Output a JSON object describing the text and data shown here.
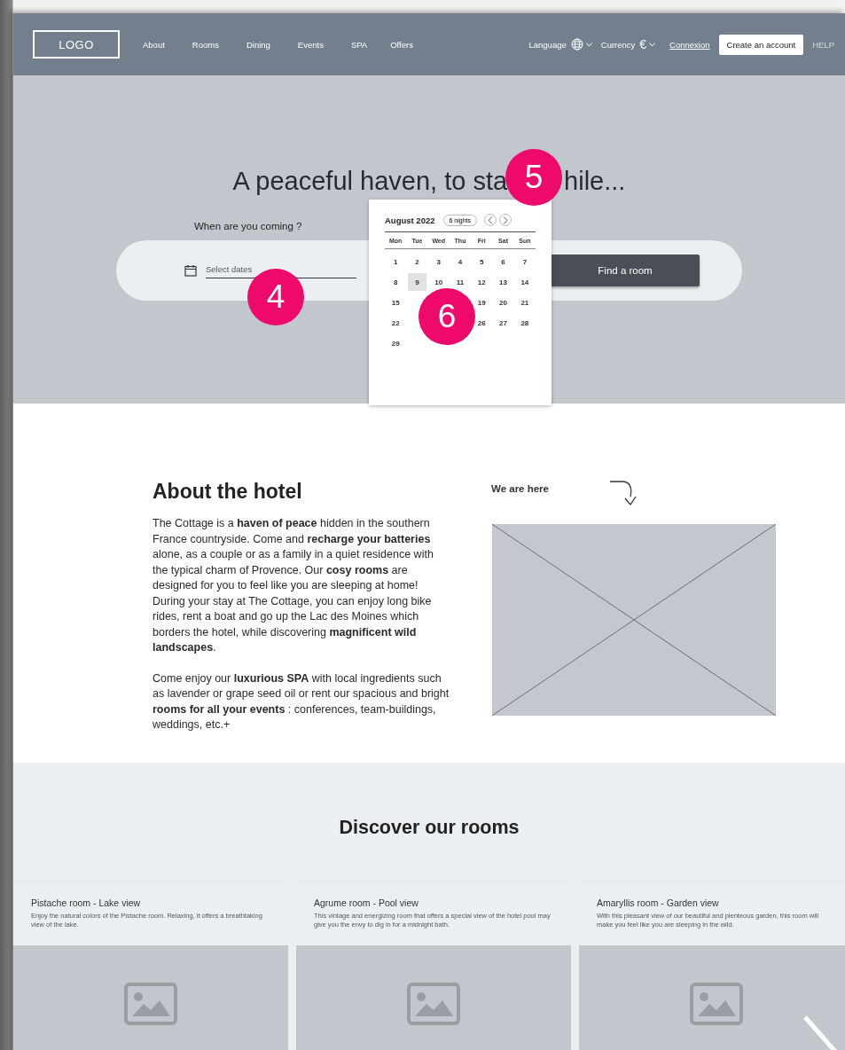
{
  "header": {
    "logo": "LOGO",
    "nav": [
      {
        "label": "About"
      },
      {
        "label": "Rooms"
      },
      {
        "label": "Dining"
      },
      {
        "label": "Events"
      },
      {
        "label": "SPA"
      },
      {
        "label": "Offers"
      }
    ],
    "language": "Language",
    "currency": "Currency",
    "currency_symbol": "€",
    "login": "Connexion",
    "signup": "Create an account",
    "help": "HELP"
  },
  "hero": {
    "headline_start": "A peaceful haven, to sta",
    "headline_end": "hile...",
    "question": "When are you coming ?",
    "date_field": {
      "placeholder": "Select dates"
    },
    "submit": "Find a room"
  },
  "markers": [
    {
      "label": "5"
    },
    {
      "label": "4"
    },
    {
      "label": "6"
    }
  ],
  "calendar": {
    "month": "August 2022",
    "nights": "6 nights",
    "weekdays": [
      "Mon",
      "Tue",
      "Wed",
      "Thu",
      "Fri",
      "Sat",
      "Sun"
    ],
    "weeks": [
      [
        {
          "kind": "day",
          "text": "1",
          "selected": false
        },
        {
          "kind": "day",
          "text": "2",
          "selected": false
        },
        {
          "kind": "day",
          "text": "3",
          "selected": false
        },
        {
          "kind": "day",
          "text": "4",
          "selected": false
        },
        {
          "kind": "day",
          "text": "5",
          "selected": false
        },
        {
          "kind": "day",
          "text": "6",
          "selected": false
        },
        {
          "kind": "day",
          "text": "7",
          "selected": false
        }
      ],
      [
        {
          "kind": "day",
          "text": "8",
          "selected": false
        },
        {
          "kind": "day",
          "text": "9",
          "selected": true
        },
        {
          "kind": "day",
          "text": "10",
          "selected": false
        },
        {
          "kind": "day",
          "text": "11",
          "selected": false
        },
        {
          "kind": "day",
          "text": "12",
          "selected": false
        },
        {
          "kind": "day",
          "text": "13",
          "selected": false
        },
        {
          "kind": "day",
          "text": "14",
          "selected": false
        }
      ],
      [
        {
          "kind": "day",
          "text": "15",
          "selected": false
        },
        {
          "kind": "covered"
        },
        {
          "kind": "covered"
        },
        {
          "kind": "covered"
        },
        {
          "kind": "day",
          "text": "19",
          "selected": false
        },
        {
          "kind": "day",
          "text": "20",
          "selected": false
        },
        {
          "kind": "day",
          "text": "21",
          "selected": false
        }
      ],
      [
        {
          "kind": "day",
          "text": "22",
          "selected": false
        },
        {
          "kind": "covered"
        },
        {
          "kind": "covered"
        },
        {
          "kind": "covered"
        },
        {
          "kind": "day",
          "text": "26",
          "selected": false
        },
        {
          "kind": "day",
          "text": "27",
          "selected": false
        },
        {
          "kind": "day",
          "text": "28",
          "selected": false
        }
      ],
      [
        {
          "kind": "day",
          "text": "29",
          "selected": false
        },
        {
          "kind": "covered"
        }
      ]
    ]
  },
  "about": {
    "title": "About the hotel",
    "paragraphs": [
      "The Cottage is a **haven of peace** hidden in the southern France countryside. Come and **recharge your batteries** alone, as a couple or as a family in a quiet residence with the typical charm of Provence. Our **cosy rooms** are designed for you to feel like you are sleeping at home! During your stay at The Cottage, you can enjoy long bike rides, rent a boat and go up the Lac des Moines which borders the hotel, while discovering **magnificent wild landscapes**.",
      "Come enjoy our **luxurious SPA** with local ingredients such as lavender or grape seed oil or rent our spacious and bright **rooms for all your events** : conferences, team-buildings, weddings, etc.+"
    ],
    "map_label": "We are here"
  },
  "rooms": {
    "title": "Discover our rooms",
    "cards": [
      {
        "title": "Pistache room - Lake view",
        "description": "Enjoy the natural colors of the Pistache room. Relaxing, it offers a breathtaking view of the lake."
      },
      {
        "title": "Agrume room - Pool view",
        "description": "This vintage and energizing room that offers a special view of the hotel pool may give you the envy to dig in for a midnight bath."
      },
      {
        "title": "Amaryllis room - Garden view",
        "description": "With this pleasant view of our beautiful and plenteous garden, this room will make you feel like you are sleeping in the wild."
      }
    ]
  }
}
